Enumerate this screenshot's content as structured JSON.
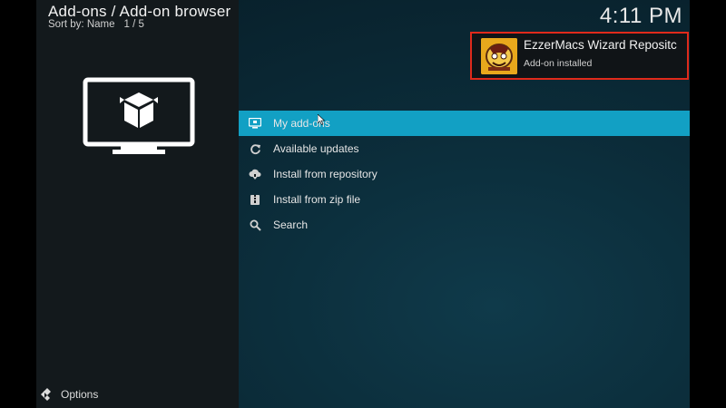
{
  "header": {
    "title": "Add-ons / Add-on browser",
    "sort_label": "Sort by: Name",
    "page_indicator": "1 / 5"
  },
  "clock": "4:11 PM",
  "notification": {
    "title": "EzzerMacs Wizard Repositc",
    "message": "Add-on installed",
    "highlight_color": "#e02a1b"
  },
  "menu": {
    "items": [
      {
        "label": "My add-ons",
        "icon": "monitor-icon",
        "selected": true
      },
      {
        "label": "Available updates",
        "icon": "refresh-icon",
        "selected": false
      },
      {
        "label": "Install from repository",
        "icon": "cloud-download-icon",
        "selected": false
      },
      {
        "label": "Install from zip file",
        "icon": "zip-file-icon",
        "selected": false
      },
      {
        "label": "Search",
        "icon": "search-icon",
        "selected": false
      }
    ]
  },
  "footer": {
    "options_label": "Options"
  },
  "colors": {
    "accent": "#12a0c4",
    "panel": "#13191c",
    "background": "#0b2b38"
  }
}
